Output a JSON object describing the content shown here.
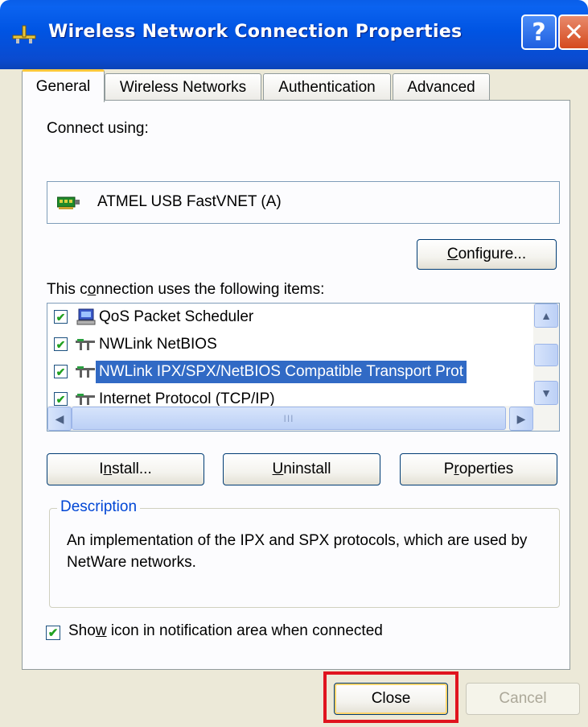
{
  "window": {
    "title": "Wireless Network Connection Properties",
    "help_button": "?",
    "close_button": "✕"
  },
  "tabs": [
    {
      "label": "General",
      "active": true
    },
    {
      "label": "Wireless Networks",
      "active": false
    },
    {
      "label": "Authentication",
      "active": false
    },
    {
      "label": "Advanced",
      "active": false
    }
  ],
  "general": {
    "connect_using_label": "Connect using:",
    "adapter_name": "ATMEL USB FastVNET (A)",
    "configure_button": {
      "pre": "",
      "accel": "C",
      "post": "onfigure..."
    },
    "items_label": {
      "pre": "This c",
      "accel": "o",
      "post": "nnection uses the following items:"
    },
    "items": [
      {
        "label": "QoS Packet Scheduler",
        "checked": true,
        "icon": "scheduler-icon"
      },
      {
        "label": "NWLink NetBIOS",
        "checked": true,
        "icon": "network-protocol-icon"
      },
      {
        "label": "NWLink IPX/SPX/NetBIOS Compatible Transport Prot",
        "checked": true,
        "icon": "network-protocol-icon",
        "selected": true
      },
      {
        "label": "Internet Protocol (TCP/IP)",
        "checked": true,
        "icon": "network-protocol-icon"
      }
    ],
    "install_button": {
      "pre": "I",
      "accel": "n",
      "post": "stall..."
    },
    "uninstall_button": {
      "pre": "",
      "accel": "U",
      "post": "ninstall"
    },
    "properties_button": {
      "pre": "P",
      "accel": "r",
      "post": "operties"
    },
    "description_legend": "Description",
    "description_text": "An implementation of the IPX and SPX protocols, which are used by NetWare networks.",
    "show_icon": {
      "pre": "Sho",
      "accel": "w",
      "post": " icon in notification area when connected",
      "checked": true
    }
  },
  "footer": {
    "close_button": "Close",
    "cancel_button": "Cancel"
  },
  "colors": {
    "title_bar": "#0054e3",
    "selection": "#316ac5",
    "highlight_box": "#e0141e",
    "group_legend": "#0046d5"
  }
}
